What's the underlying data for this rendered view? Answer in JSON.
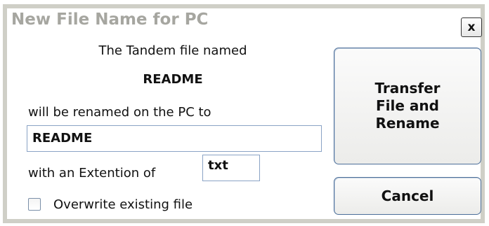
{
  "dialog": {
    "title": "New File Name for PC",
    "close_label": "x"
  },
  "content": {
    "intro_text": "The Tandem file named",
    "source_file": "README",
    "rename_text": "will be renamed on the PC to",
    "new_name_value": "README",
    "extension_label": "with an Extention of",
    "extension_value": "txt",
    "overwrite_label": "Overwrite existing file",
    "overwrite_checked": false
  },
  "buttons": {
    "transfer_line1": "Transfer",
    "transfer_line2": "File and",
    "transfer_line3": "Rename",
    "cancel_label": "Cancel"
  }
}
